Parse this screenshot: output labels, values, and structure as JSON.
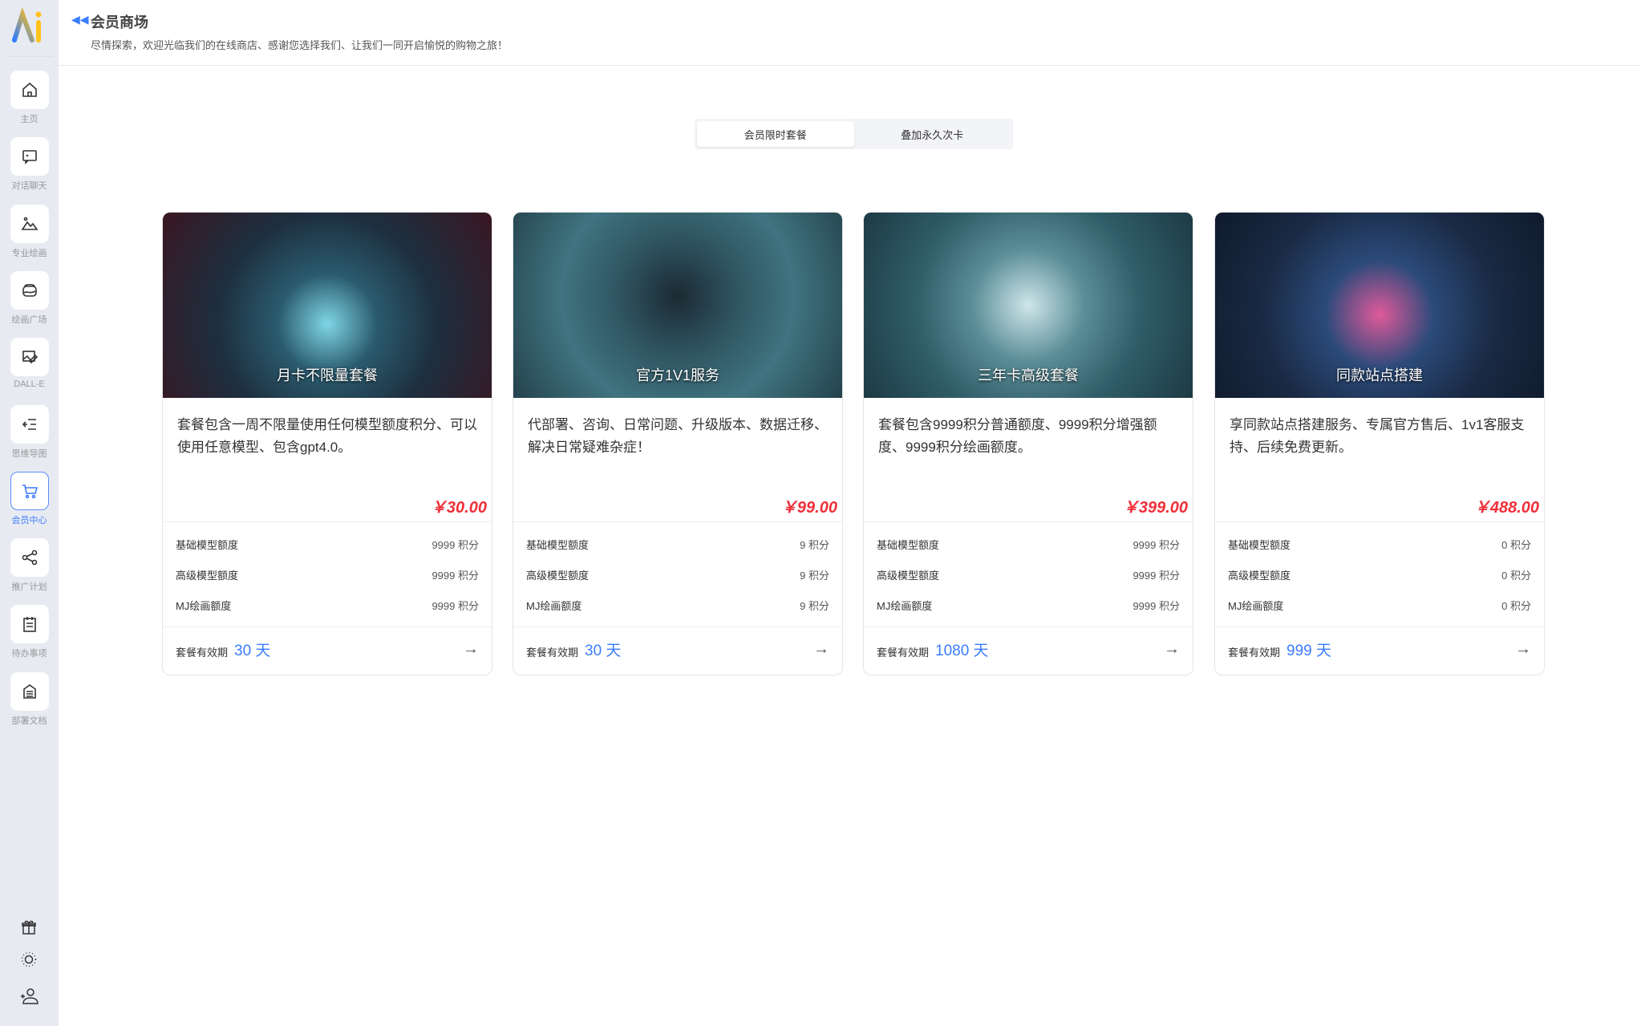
{
  "sidebar": {
    "items": [
      {
        "label": "主页",
        "icon": "home-icon"
      },
      {
        "label": "对话聊天",
        "icon": "chat-icon"
      },
      {
        "label": "专业绘画",
        "icon": "mountain-icon"
      },
      {
        "label": "绘画广场",
        "icon": "gallery-icon"
      },
      {
        "label": "DALL-E",
        "icon": "image-edit-icon"
      },
      {
        "label": "思维导图",
        "icon": "mindmap-icon"
      },
      {
        "label": "会员中心",
        "icon": "cart-icon",
        "active": true
      },
      {
        "label": "推广计划",
        "icon": "share-icon"
      },
      {
        "label": "待办事项",
        "icon": "clipboard-icon"
      },
      {
        "label": "部署文档",
        "icon": "document-icon"
      }
    ],
    "bottom": [
      "gift-icon",
      "sun-icon",
      "user-add-icon"
    ]
  },
  "header": {
    "title": "会员商场",
    "subtitle": "尽情探索，欢迎光临我们的在线商店、感谢您选择我们、让我们一同开启愉悦的购物之旅！"
  },
  "tabs": [
    {
      "label": "会员限时套餐",
      "active": true
    },
    {
      "label": "叠加永久次卡"
    }
  ],
  "labels": {
    "basic": "基础模型额度",
    "advanced": "高级模型额度",
    "mj": "MJ绘画额度",
    "validity": "套餐有效期"
  },
  "colors": {
    "accent": "#3b7cff",
    "price": "#f0303a"
  },
  "cards": [
    {
      "image_title": "月卡不限量套餐",
      "desc": "套餐包含一周不限量使用任何模型额度积分、可以使用任意模型、包含gpt4.0。",
      "price": "￥30.00",
      "basic": "9999 积分",
      "advanced": "9999 积分",
      "mj": "9999 积分",
      "days": "30 天"
    },
    {
      "image_title": "官方1V1服务",
      "desc": "代部署、咨询、日常问题、升级版本、数据迁移、解决日常疑难杂症！",
      "price": "￥99.00",
      "basic": "9 积分",
      "advanced": "9 积分",
      "mj": "9 积分",
      "days": "30 天"
    },
    {
      "image_title": "三年卡高级套餐",
      "desc": "套餐包含9999积分普通额度、9999积分增强额度、9999积分绘画额度。",
      "price": "￥399.00",
      "basic": "9999 积分",
      "advanced": "9999 积分",
      "mj": "9999 积分",
      "days": "1080 天"
    },
    {
      "image_title": "同款站点搭建",
      "desc": "享同款站点搭建服务、专属官方售后、1v1客服支持、后续免费更新。",
      "price": "￥488.00",
      "basic": "0 积分",
      "advanced": "0 积分",
      "mj": "0 积分",
      "days": "999 天"
    }
  ]
}
